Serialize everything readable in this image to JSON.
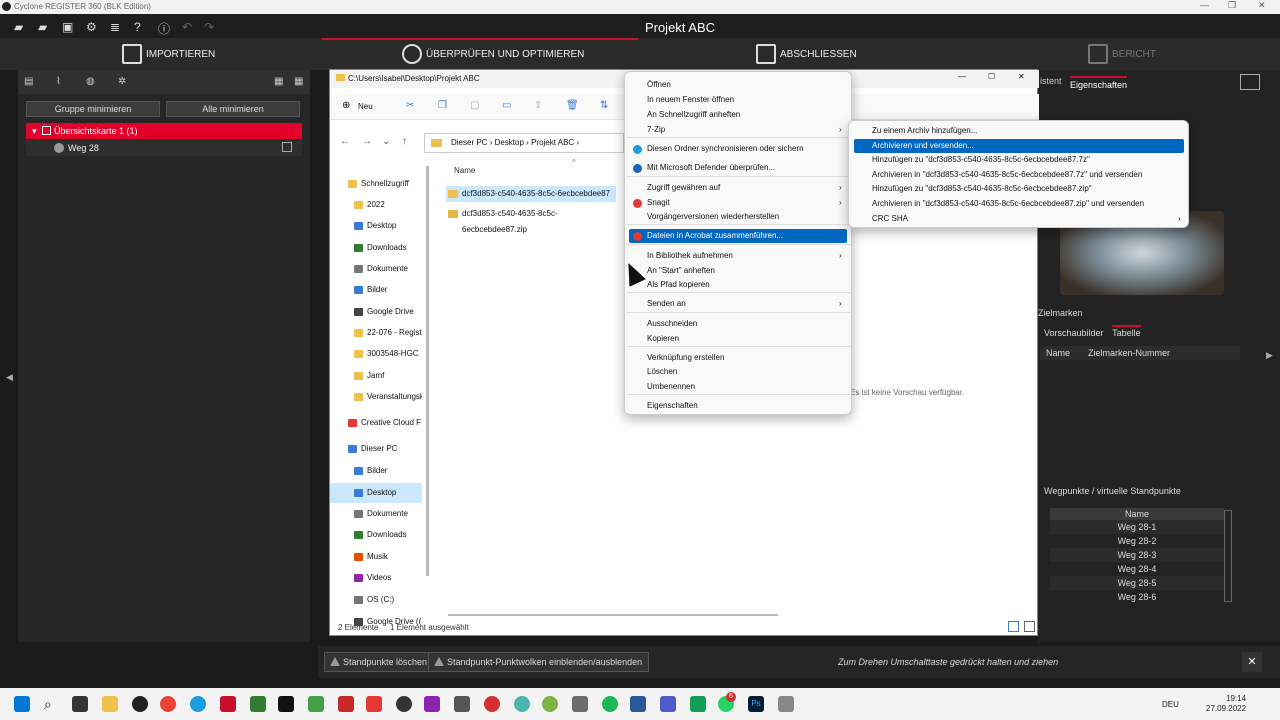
{
  "app": {
    "window_title": "Cyclone REGISTER 360 (BLK Edition)",
    "project_title": "Projekt ABC"
  },
  "workflow": {
    "steps": [
      "IMPORTIEREN",
      "ÜBERPRÜFEN UND OPTIMIEREN",
      "ABSCHLIESSEN",
      "BERICHT"
    ]
  },
  "left_panel": {
    "btn_group_min": "Gruppe minimieren",
    "btn_all_min": "Alle minimieren",
    "tree": [
      {
        "label": "Übersichtskarte 1 (1)"
      },
      {
        "label": "Weg 28"
      }
    ]
  },
  "right_panel": {
    "tabs": [
      "istent",
      "Eigenschaften"
    ],
    "zielmarken": "Zielmarken",
    "subtabs": [
      "Vorschaubilder",
      "Tabelle"
    ],
    "columns": [
      "Name",
      "Zielmarken-Nummer"
    ],
    "wegpunkte_title": "Wegpunkte / virtuelle Standpunkte",
    "wp_header": "Name",
    "wegpunkte": [
      "Weg 28-1",
      "Weg 28-2",
      "Weg 28-3",
      "Weg 28-4",
      "Weg 28-5",
      "Weg 28-6"
    ]
  },
  "bottom_bar": {
    "btn_delete": "Standpunkte löschen",
    "btn_toggle": "Standpunkt-Punktwolken einblenden/ausblenden",
    "hint": "Zum Drehen Umschalttaste gedrückt halten und ziehen",
    "close": "✕"
  },
  "explorer": {
    "title": "C:\\Users\\Isabel\\Desktop\\Projekt ABC",
    "new_label": "Neu",
    "breadcrumb": [
      "Dieser PC",
      "Desktop",
      "Projekt ABC"
    ],
    "column_name": "Name",
    "nav": [
      {
        "label": "Schnellzugriff"
      },
      {
        "label": "2022"
      },
      {
        "label": "Desktop"
      },
      {
        "label": "Downloads"
      },
      {
        "label": "Dokumente"
      },
      {
        "label": "Bilder"
      },
      {
        "label": "Google Drive"
      },
      {
        "label": "22-076 - Regist"
      },
      {
        "label": "3003548-HGC"
      },
      {
        "label": "Jamf"
      },
      {
        "label": "Veranstaltungsk"
      },
      {
        "label": "Creative Cloud F"
      },
      {
        "label": "Dieser PC"
      },
      {
        "label": "Bilder"
      },
      {
        "label": "Desktop"
      },
      {
        "label": "Dokumente"
      },
      {
        "label": "Downloads"
      },
      {
        "label": "Musik"
      },
      {
        "label": "Videos"
      },
      {
        "label": "OS (C:)"
      },
      {
        "label": "Google Drive (("
      }
    ],
    "files": [
      "dcf3d853-c540-4635-8c5c-6ecbcebdee87",
      "dcf3d853-c540-4635-8c5c-6ecbcebdee87.zip"
    ],
    "status_items": "2 Elemente",
    "status_selected": "1 Element ausgewählt",
    "preview_text": "Es ist keine Vorschau verfügbar."
  },
  "context_menu": {
    "items": [
      "Öffnen",
      "In neuem Fenster öffnen",
      "An Schnellzugriff anheften",
      "7-Zip",
      "Diesen Ordner synchronisieren oder sichern",
      "Mit Microsoft Defender überprüfen...",
      "Zugriff gewähren auf",
      "Snagit",
      "Vorgängerversionen wiederherstellen",
      "Dateien in Acrobat zusammenführen...",
      "In Bibliothek aufnehmen",
      "An \"Start\" anheften",
      "Als Pfad kopieren",
      "Senden an",
      "Ausschneiden",
      "Kopieren",
      "Verknüpfung erstellen",
      "Löschen",
      "Umbenennen",
      "Eigenschaften"
    ]
  },
  "submenu_7zip": {
    "items": [
      "Zu einem Archiv hinzufügen...",
      "Archivieren und versenden...",
      "Hinzufügen zu \"dcf3d853-c540-4635-8c5c-6ecbcebdee87.7z\"",
      "Archivieren in \"dcf3d853-c540-4635-8c5c-6ecbcebdee87.7z\" und versenden",
      "Hinzufügen zu \"dcf3d853-c540-4635-8c5c-6ecbcebdee87.zip\"",
      "Archivieren in \"dcf3d853-c540-4635-8c5c-6ecbcebdee87.zip\" und versenden",
      "CRC SHA"
    ]
  },
  "taskbar": {
    "lang": "DEU",
    "time": "19:14",
    "date": "27.09.2022",
    "badge": "6"
  }
}
